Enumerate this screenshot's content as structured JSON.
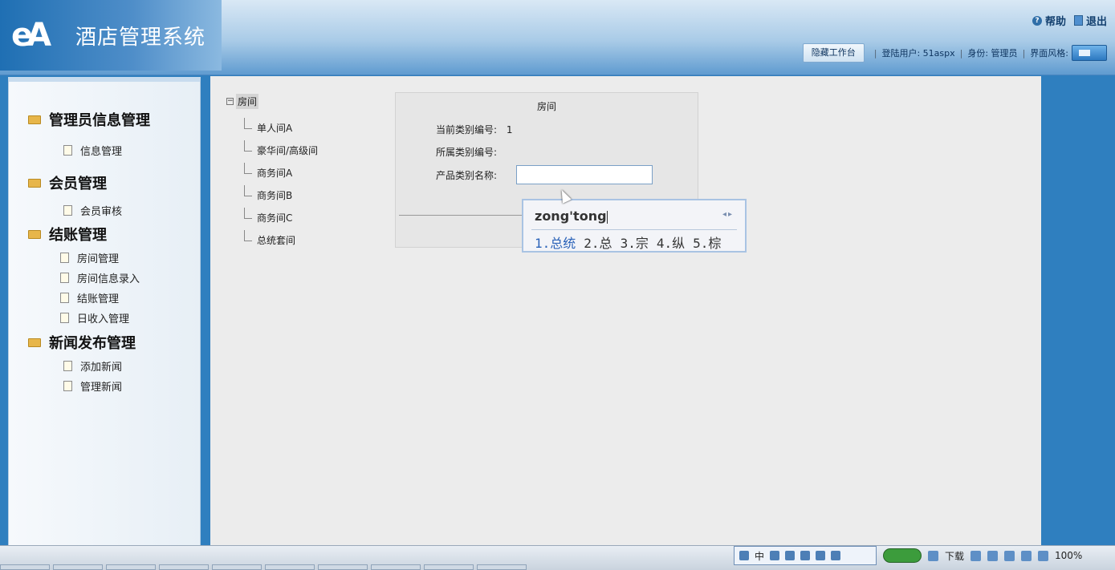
{
  "header": {
    "app_title": "酒店管理系统",
    "logo_text": "eA",
    "help_label": "帮助",
    "exit_label": "退出"
  },
  "toolbar": {
    "hide_button": "隐藏工作台",
    "login_user": "登陆用户: 51aspx",
    "role": "身份: 管理员",
    "theme_label": "界面风格:"
  },
  "sidebar": {
    "groups": [
      {
        "label": "管理员信息管理",
        "items": [
          "信息管理"
        ]
      },
      {
        "label": "会员管理",
        "items": [
          "会员审核"
        ]
      },
      {
        "label": "结账管理",
        "items": [
          "房间管理",
          "房间信息录入",
          "结账管理",
          "日收入管理"
        ]
      },
      {
        "label": "新闻发布管理",
        "items": [
          "添加新闻",
          "管理新闻"
        ]
      }
    ]
  },
  "tree": {
    "root": "房间",
    "nodes": [
      "单人间A",
      "豪华间/高级间",
      "商务间A",
      "商务间B",
      "商务间C",
      "总统套间"
    ]
  },
  "form": {
    "title": "房间",
    "current_id_label": "当前类别编号:",
    "current_id_value": "1",
    "parent_id_label": "所属类别编号:",
    "name_label": "产品类别名称:",
    "name_value": ""
  },
  "ime": {
    "composition": "zong'tong",
    "candidates": [
      "1.总统",
      "2.总",
      "3.宗",
      "4.纵",
      "5.棕"
    ]
  },
  "status": {
    "download": "下载",
    "zoom": "100%",
    "tray": [
      "中"
    ]
  }
}
